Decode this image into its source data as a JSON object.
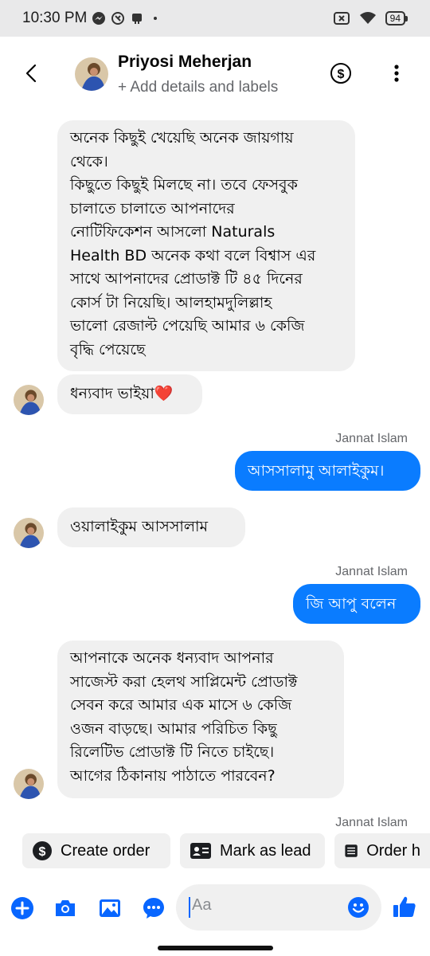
{
  "status_bar": {
    "time": "10:30 PM",
    "battery": "94"
  },
  "header": {
    "name": "Priyosi Meherjan",
    "subtitle": "+ Add details and labels",
    "icons": [
      "back-icon",
      "dollar-icon",
      "more-icon"
    ]
  },
  "messages": [
    {
      "from": "contact",
      "text": "অনেক কিছুই খেয়েছি অনেক জায়গায়\nথেকে।\nকিছুতে কিছুই মিলছে না। তবে ফেসবুক\nচালাতে চালাতে আপনাদের\nনোটিফিকেশন আসলো Naturals\nHealth BD অনেক কথা বলে বিশ্বাস এর\nসাথে আপনাদের প্রোডাক্ট টি ৪৫ দিনের\nকোর্স টা নিয়েছি। আলহামদুলিল্লাহ\nভালো রেজাল্ট পেয়েছি আমার ৬ কেজি\nবৃদ্ধি পেয়েছে"
    },
    {
      "from": "contact",
      "text": "ধন্যবাদ ভাইয়া❤️"
    },
    {
      "from": "me",
      "sender": "Jannat Islam",
      "text": "আসসালামু আলাইকুম।"
    },
    {
      "from": "contact",
      "text": "ওয়ালাইকুম আসসালাম"
    },
    {
      "from": "me",
      "sender": "Jannat Islam",
      "text": "জি আপু বলেন"
    },
    {
      "from": "contact",
      "text": "আপনাকে অনেক ধন্যবাদ আপনার\nসাজেস্ট করা হেলথ সাপ্লিমেন্ট প্রোডাক্ট\nসেবন করে আমার এক মাসে ৬ কেজি\nওজন বাড়ছে। আমার পরিচিত কিছু\nরিলেটিভ প্রোডাক্ট টি নিতে চাইছে।\nআগের ঠিকানায় পাঠাতে পারবেন?"
    }
  ],
  "trailing_sender": "Jannat Islam",
  "quick_actions": [
    "Create order",
    "Mark as lead",
    "Order h"
  ],
  "composer": {
    "placeholder": "Aa"
  },
  "colors": {
    "accent": "#0a7cff",
    "incoming_bubble": "#f0f0f0",
    "secondary_text": "#65676b"
  }
}
